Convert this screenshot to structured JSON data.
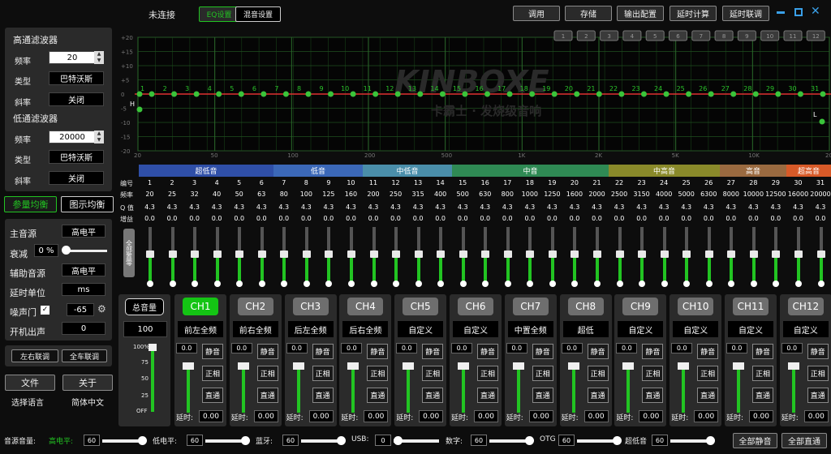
{
  "header": {
    "status": "未连接",
    "tab_eq": "EQ设置",
    "tab_mix": "混音设置",
    "btn_call": "调用",
    "btn_save": "存储",
    "btn_output": "输出配置",
    "btn_delay": "延时计算",
    "btn_delay_link": "延时联调",
    "presets": [
      "1",
      "2",
      "3",
      "4",
      "5",
      "6",
      "7",
      "8",
      "9",
      "10",
      "11",
      "12"
    ]
  },
  "left": {
    "hpf_title": "高通滤波器",
    "freq_label": "频率",
    "type_label": "类型",
    "slope_label": "斜率",
    "hpf_freq": "20",
    "hpf_type": "巴特沃斯",
    "hpf_slope": "关闭",
    "lpf_title": "低通滤波器",
    "lpf_freq": "20000",
    "lpf_type": "巴特沃斯",
    "lpf_slope": "关闭",
    "tab_param": "参量均衡",
    "tab_graphic": "图示均衡",
    "main_src_label": "主音源",
    "main_src": "高电平",
    "atten_label": "衰减",
    "atten": "0 %",
    "aux_src_label": "辅助音源",
    "aux_src": "高电平",
    "delay_unit_label": "延时单位",
    "delay_unit": "ms",
    "noise_label": "噪声门",
    "noise_val": "-65",
    "boot_label": "开机出声",
    "boot_val": "0",
    "btn_lr_link": "左右联调",
    "btn_all_link": "全车联调",
    "btn_file": "文件",
    "btn_about": "关于",
    "lang_label": "选择语言",
    "lang_val": "简体中文"
  },
  "graph": {
    "y_ticks": [
      "+20",
      "+15",
      "+10",
      "+5",
      "0",
      "-5",
      "-10",
      "-15",
      "-20"
    ],
    "x_ticks": [
      "20",
      "50",
      "100",
      "200",
      "500",
      "1K",
      "2K",
      "5K",
      "10K",
      "20K"
    ],
    "points": [
      "1",
      "2",
      "3",
      "4",
      "5",
      "6",
      "7",
      "8",
      "9",
      "10",
      "11",
      "12",
      "13",
      "14",
      "15",
      "16",
      "17",
      "18",
      "19",
      "20",
      "21",
      "22",
      "23",
      "24",
      "25",
      "26",
      "27",
      "28",
      "29",
      "30",
      "31"
    ],
    "marker_h": "H",
    "marker_l": "L",
    "watermark": "KINBOXE",
    "watermark_sub": "卡霸士 · 发烧级音响"
  },
  "bands": [
    {
      "label": "超低音",
      "color": "#2f4fa8"
    },
    {
      "label": "低音",
      "color": "#3b68b8"
    },
    {
      "label": "中低音",
      "color": "#4a8eaa"
    },
    {
      "label": "中音",
      "color": "#2f8a54"
    },
    {
      "label": "中高音",
      "color": "#8a8a2a"
    },
    {
      "label": "高音",
      "color": "#9a6a40"
    },
    {
      "label": "超高音",
      "color": "#d85a28"
    }
  ],
  "eq": {
    "row_labels": {
      "num": "编号",
      "freq": "频率",
      "q": "Q 值",
      "gain": "增益"
    },
    "reset_btn": "全部置零",
    "freqs": [
      "20",
      "25",
      "32",
      "40",
      "50",
      "63",
      "80",
      "100",
      "125",
      "160",
      "200",
      "250",
      "315",
      "400",
      "500",
      "630",
      "800",
      "1000",
      "1250",
      "1600",
      "2000",
      "2500",
      "3150",
      "4000",
      "5000",
      "6300",
      "8000",
      "10000",
      "12500",
      "16000",
      "20000"
    ],
    "q": "4.3",
    "gain": "0.0"
  },
  "channels": {
    "master_label": "总音量",
    "master_value": "100",
    "scale": [
      "100%",
      "75",
      "50",
      "25",
      "OFF"
    ],
    "mute_label": "静音",
    "phase_label": "正相",
    "pass_label": "直通",
    "delay_label": "延时:",
    "list": [
      {
        "id": "CH1",
        "name": "前左全频",
        "db": "0.0",
        "delay": "0.00",
        "active": true
      },
      {
        "id": "CH2",
        "name": "前右全频",
        "db": "0.0",
        "delay": "0.00"
      },
      {
        "id": "CH3",
        "name": "后左全频",
        "db": "0.0",
        "delay": "0.00"
      },
      {
        "id": "CH4",
        "name": "后右全频",
        "db": "0.0",
        "delay": "0.00"
      },
      {
        "id": "CH5",
        "name": "自定义",
        "db": "0.0",
        "delay": "0.00"
      },
      {
        "id": "CH6",
        "name": "自定义",
        "db": "0.0",
        "delay": "0.00"
      },
      {
        "id": "CH7",
        "name": "中置全频",
        "db": "0.0",
        "delay": "0.00"
      },
      {
        "id": "CH8",
        "name": "超低",
        "db": "0.0",
        "delay": "0.00"
      },
      {
        "id": "CH9",
        "name": "自定义",
        "db": "0.0",
        "delay": "0.00"
      },
      {
        "id": "CH10",
        "name": "自定义",
        "db": "0.0",
        "delay": "0.00"
      },
      {
        "id": "CH11",
        "name": "自定义",
        "db": "0.0",
        "delay": "0.00"
      },
      {
        "id": "CH12",
        "name": "自定义",
        "db": "0.0",
        "delay": "0.00"
      }
    ]
  },
  "bottom": {
    "src_vol": "音源音量:",
    "high": "高电平:",
    "high_v": "60",
    "low": "低电平:",
    "low_v": "60",
    "bt": "蓝牙:",
    "bt_v": "60",
    "usb": "USB:",
    "usb_v": "0",
    "digital": "数字:",
    "digital_v": "60",
    "otg": "OTG",
    "otg_v": "60",
    "sub": "超低音",
    "sub_v": "60",
    "mute_all": "全部静音",
    "pass_all": "全部直通"
  }
}
